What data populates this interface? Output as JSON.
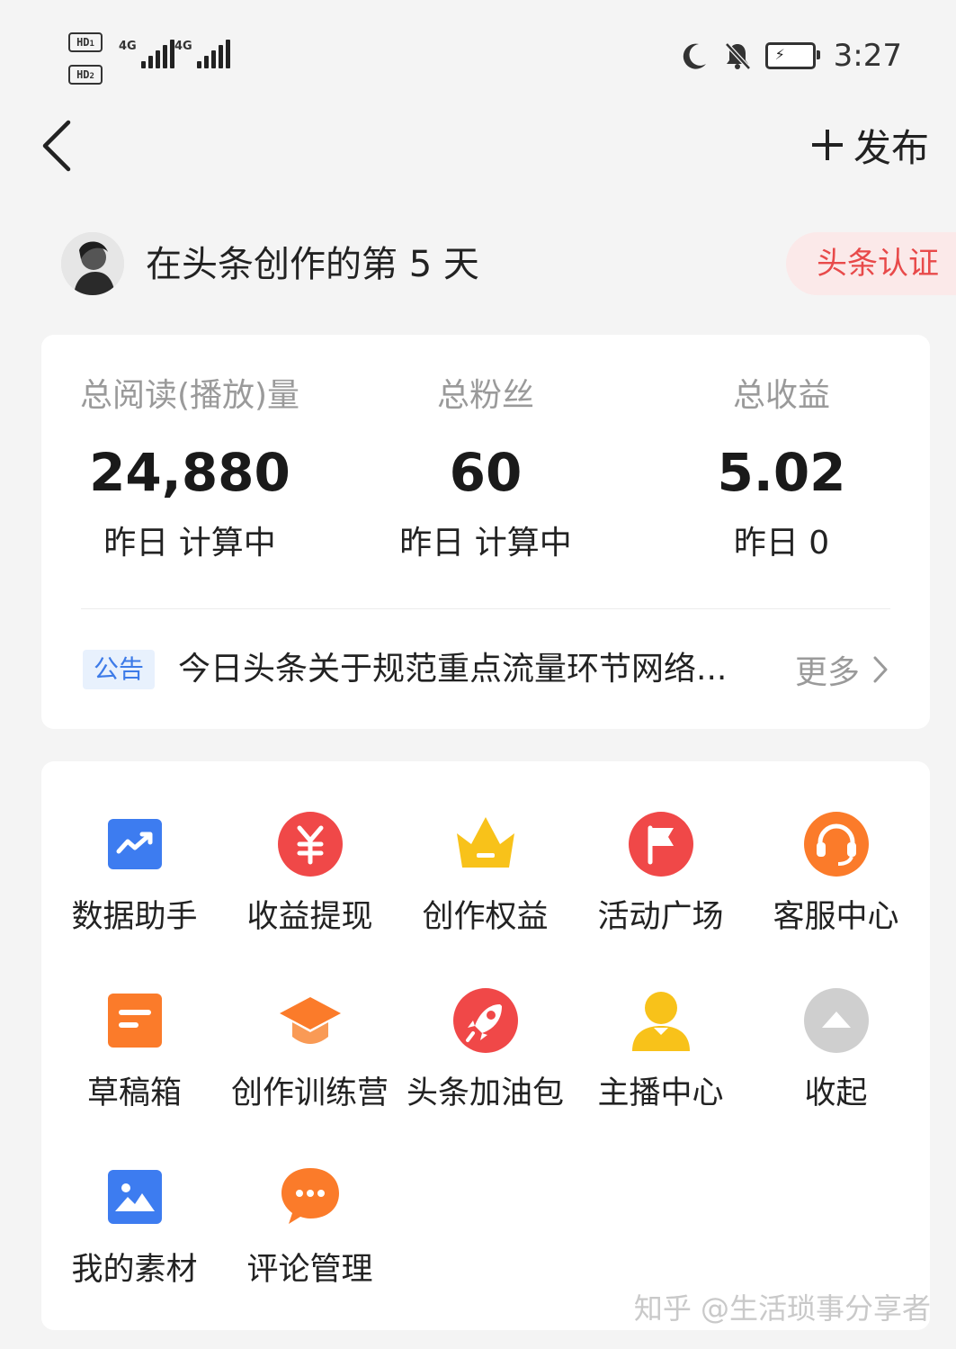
{
  "status_bar": {
    "sim1_badge": "HD",
    "sim1_index": "1",
    "sim2_badge": "HD",
    "sim2_index": "2",
    "network1": "4G",
    "network2": "4G",
    "time": "3:27",
    "icons": [
      "moon-icon",
      "bell-off-icon",
      "battery-charging-icon"
    ]
  },
  "header": {
    "back_icon": "chevron-left-icon",
    "publish_icon": "plus-icon",
    "publish_label": "发布"
  },
  "profile": {
    "creator_days_text": "在头条创作的第 5 天",
    "verify_label": "头条认证"
  },
  "stats": [
    {
      "label": "总阅读(播放)量",
      "value": "24,880",
      "sub": "昨日 计算中"
    },
    {
      "label": "总粉丝",
      "value": "60",
      "sub": "昨日 计算中"
    },
    {
      "label": "总收益",
      "value": "5.02",
      "sub": "昨日 0"
    }
  ],
  "notice": {
    "tag": "公告",
    "text": "今日头条关于规范重点流量环节网络...",
    "more_label": "更多"
  },
  "tools": [
    {
      "label": "数据助手",
      "icon": "chart-trend-icon",
      "color": "#3d7cf0"
    },
    {
      "label": "收益提现",
      "icon": "yuan-icon",
      "color": "#f04848"
    },
    {
      "label": "创作权益",
      "icon": "crown-icon",
      "color": "#f8c21a"
    },
    {
      "label": "活动广场",
      "icon": "flag-icon",
      "color": "#f04848"
    },
    {
      "label": "客服中心",
      "icon": "headset-icon",
      "color": "#fb7b2a"
    },
    {
      "label": "草稿箱",
      "icon": "draft-icon",
      "color": "#fb7b2a"
    },
    {
      "label": "创作训练营",
      "icon": "graduation-cap-icon",
      "color": "#fb7b2a"
    },
    {
      "label": "头条加油包",
      "icon": "rocket-icon",
      "color": "#f04848"
    },
    {
      "label": "主播中心",
      "icon": "user-icon",
      "color": "#f8c21a"
    },
    {
      "label": "收起",
      "icon": "collapse-up-icon",
      "color": "#cfcfcf"
    },
    {
      "label": "我的素材",
      "icon": "image-icon",
      "color": "#3d7cf0"
    },
    {
      "label": "评论管理",
      "icon": "comment-icon",
      "color": "#fb7b2a"
    }
  ],
  "watermark": "知乎 @生活琐事分享者"
}
